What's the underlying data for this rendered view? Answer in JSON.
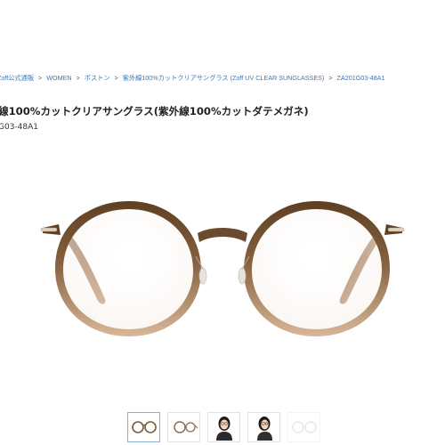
{
  "breadcrumb": [
    {
      "label": "Zoff公式通販"
    },
    {
      "label": "WOMEN"
    },
    {
      "label": "ボストン"
    },
    {
      "label": "紫外線100%カットクリアサングラス (Zoff UV CLEAR SUNGLASSES)"
    },
    {
      "label": "ZA201G03-48A1"
    }
  ],
  "breadcrumb_separator": ">",
  "product": {
    "title": "線100%カットクリアサングラス(紫外線100%カットダテメガネ)",
    "sku": "G03-48A1"
  },
  "colors": {
    "link": "#3a78b8",
    "frame_top": "#6b4a2d",
    "frame_bottom": "#cfae8e",
    "temple": "#a07652"
  },
  "thumbnails": [
    {
      "name": "thumb-front-view",
      "active": true
    },
    {
      "name": "thumb-side-view",
      "active": false
    },
    {
      "name": "thumb-model-front",
      "active": false
    },
    {
      "name": "thumb-model-angle",
      "active": false
    },
    {
      "name": "thumb-detail",
      "active": false
    }
  ]
}
